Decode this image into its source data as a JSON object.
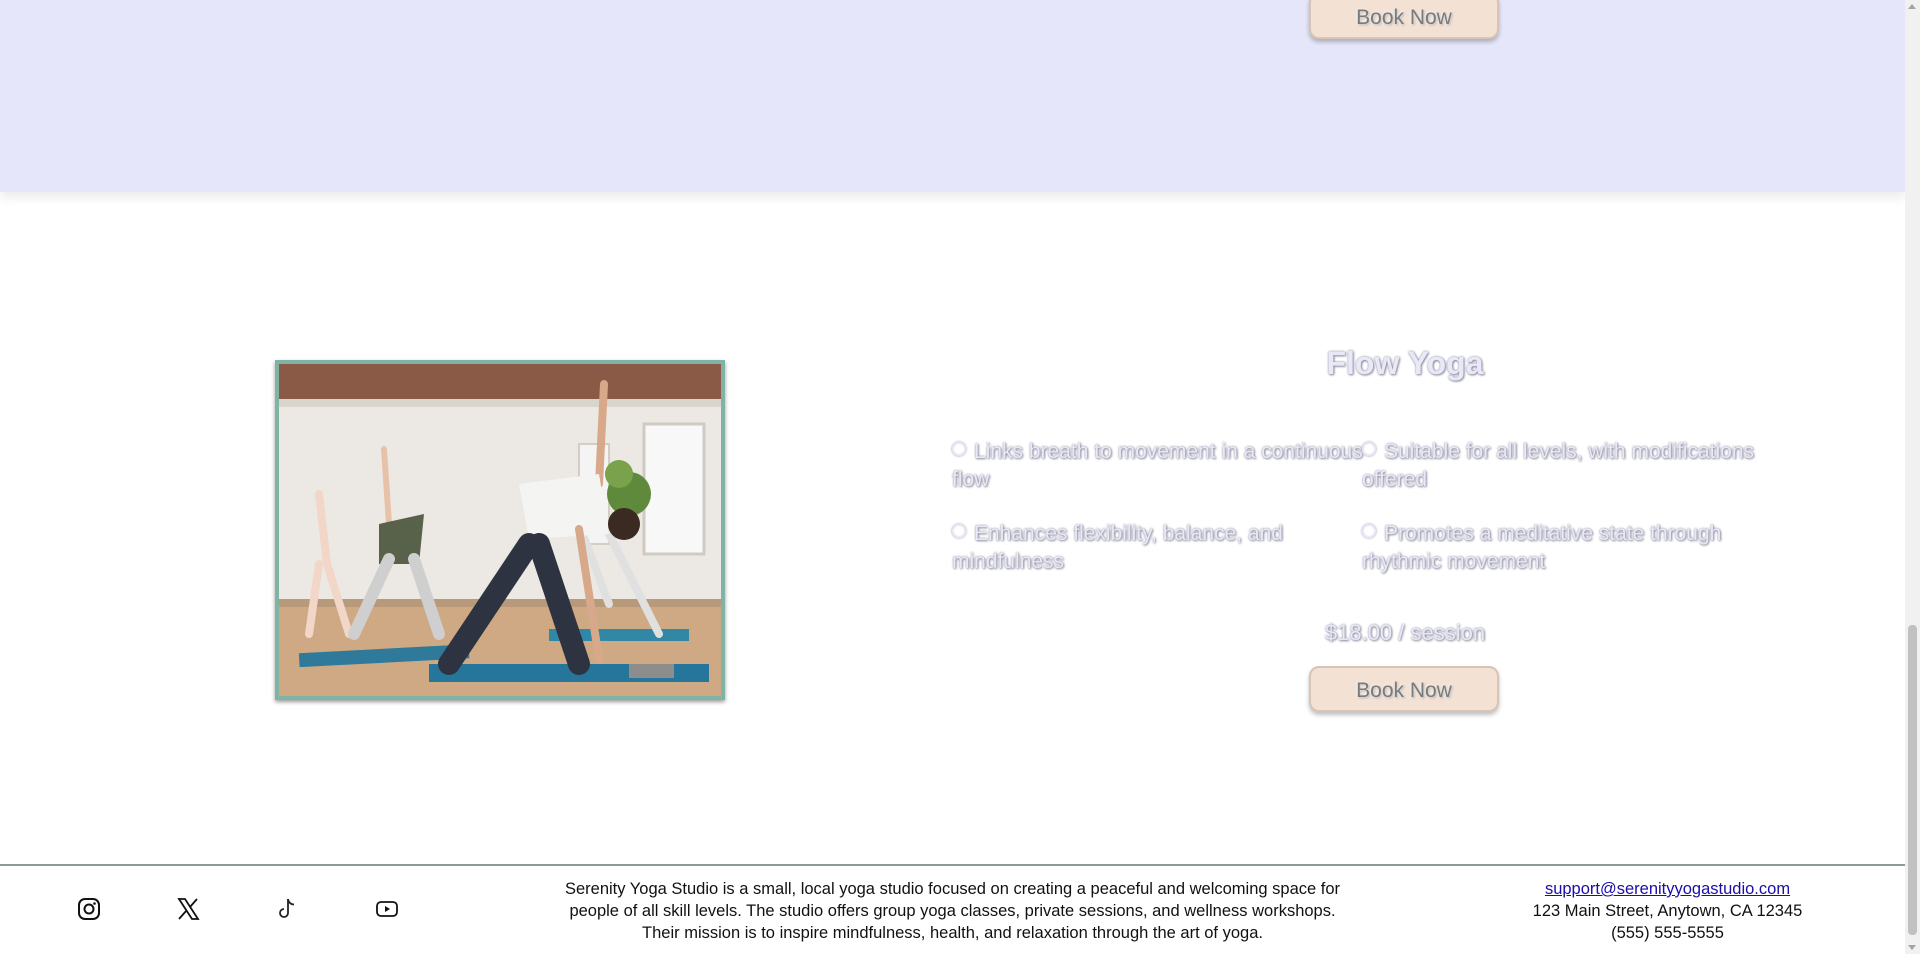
{
  "top_section": {
    "book_button_label": "Book Now"
  },
  "class": {
    "title": "Flow Yoga",
    "features": [
      "Links breath to movement in a continuous flow",
      "Suitable for all levels, with modifications offered",
      "Enhances flexibility, balance, and mindfulness",
      "Promotes a meditative state through rhythmic movement"
    ],
    "price": "$18.00 / session",
    "book_button_label": "Book Now"
  },
  "footer": {
    "social": [
      "instagram-icon",
      "x-icon",
      "tiktok-icon",
      "youtube-icon"
    ],
    "about": "Serenity Yoga Studio is a small, local yoga studio focused on creating a peaceful and welcoming space for people of all skill levels. The studio offers group yoga classes, private sessions, and wellness workshops. Their mission is to inspire mindfulness, health, and relaxation through the art of yoga.",
    "email": "support@serenityyogastudio.com",
    "address": "123 Main Street, Anytown, CA 12345",
    "phone": "(555) 555-5555"
  },
  "colors": {
    "section_bg": "#e6e6fa",
    "button_bg": "#f3e1d4",
    "photo_border": "#7fb3a6"
  }
}
